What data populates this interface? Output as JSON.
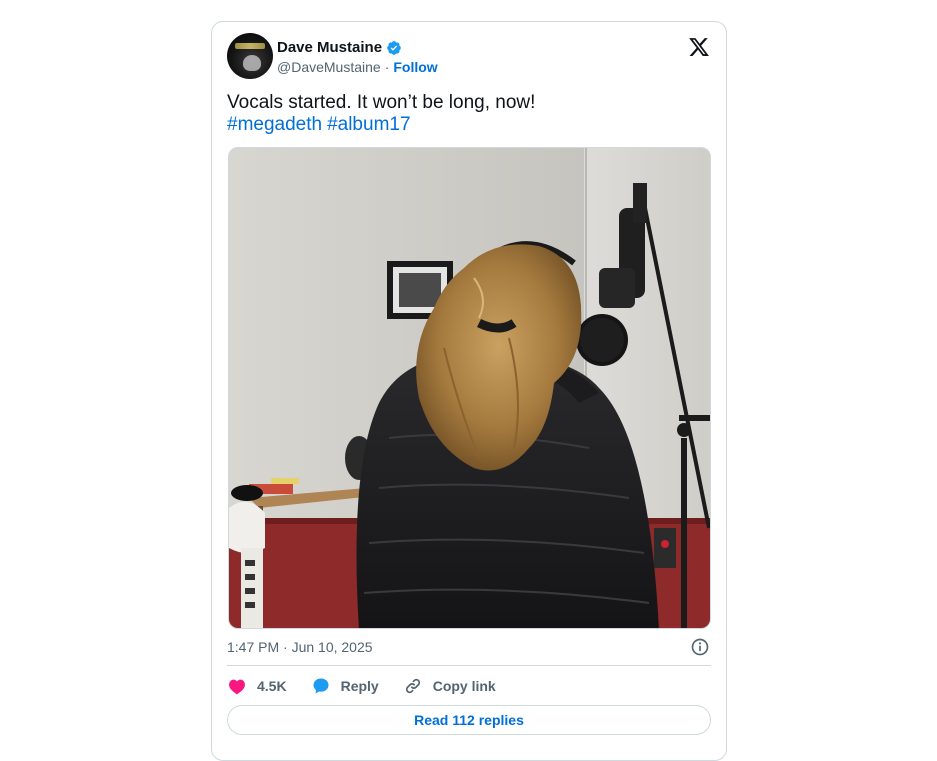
{
  "tweet": {
    "author_name": "Dave Mustaine",
    "handle": "@DaveMustaine",
    "separator": "·",
    "follow_label": "Follow",
    "text": "Vocals started. It won’t be long, now!",
    "hashtags": [
      "#megadeth",
      "#album17"
    ],
    "timestamp": "1:47 PM · Jun 10, 2025",
    "likes_count": "4.5K",
    "reply_label": "Reply",
    "copy_link_label": "Copy link",
    "read_replies_label": "Read 112 replies"
  },
  "colors": {
    "link_blue": "#006fd6",
    "like_pink": "#f91880",
    "reply_blue": "#1d9bf0",
    "muted_gray": "#536471",
    "border": "#cfd9de"
  },
  "icons": {
    "verified": "verified-badge-icon",
    "brand": "x-logo-icon",
    "info": "info-icon",
    "like": "heart-icon",
    "reply": "speech-bubble-icon",
    "copy": "link-icon"
  }
}
